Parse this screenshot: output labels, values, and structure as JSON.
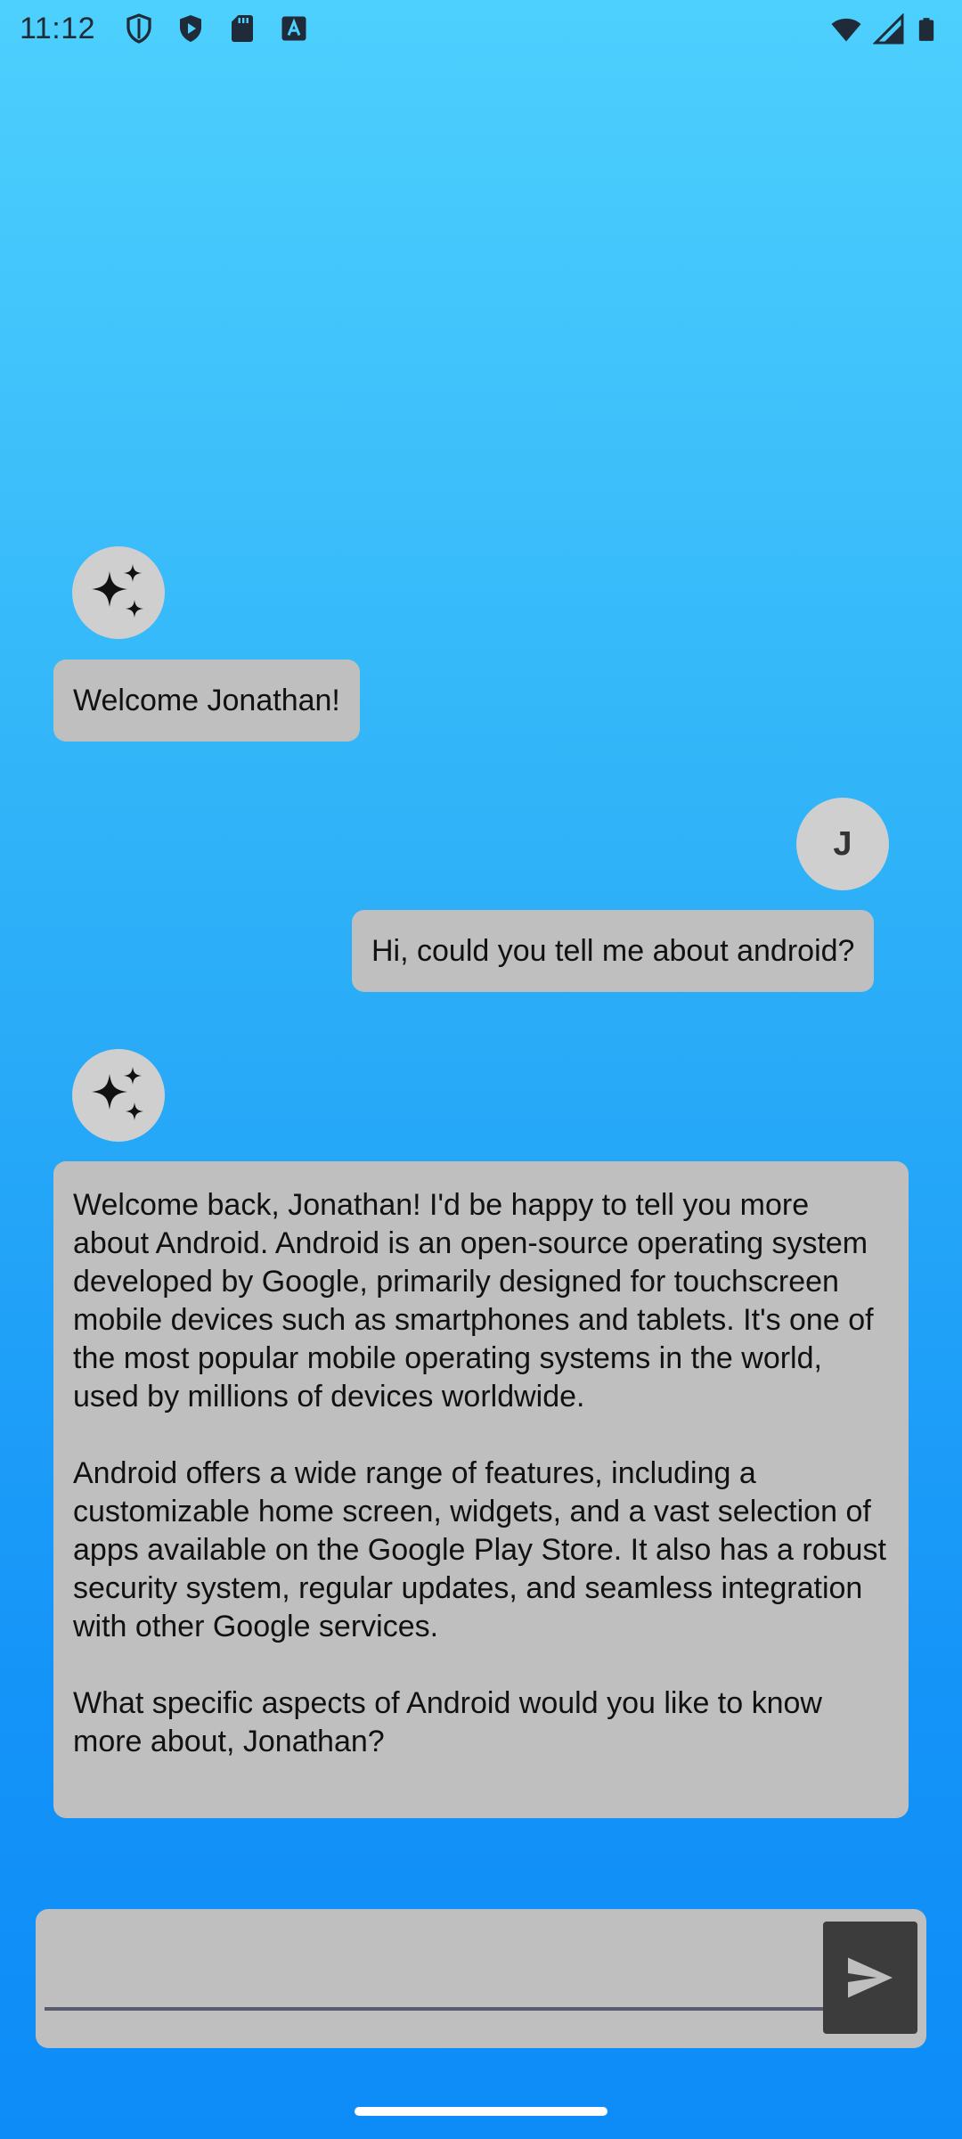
{
  "status_bar": {
    "time": "11:12",
    "left_icons": [
      "shield-icon",
      "play-protect-icon",
      "sd-card-icon",
      "font-a-icon"
    ],
    "right_icons": [
      "wifi-icon",
      "signal-icon",
      "battery-icon"
    ]
  },
  "messages": [
    {
      "sender": "bot",
      "avatar_icon": "sparkles-icon",
      "text": "Welcome Jonathan!"
    },
    {
      "sender": "user",
      "avatar_initial": "J",
      "text": "Hi, could you tell me about android?"
    },
    {
      "sender": "bot",
      "avatar_icon": "sparkles-icon",
      "text": "Welcome back, Jonathan! I'd be happy to tell you more about Android. Android is an open-source operating system developed by Google, primarily designed for touchscreen mobile devices such as smartphones and tablets. It's one of the most popular mobile operating systems in the world, used by millions of devices worldwide.\n\nAndroid offers a wide range of features, including a customizable home screen, widgets, and a vast selection of apps available on the Google Play Store. It also has a robust security system, regular updates, and seamless integration with other Google services.\n\nWhat specific aspects of Android would you like to know more about, Jonathan?"
    }
  ],
  "composer": {
    "value": "",
    "placeholder": "",
    "send_icon": "send-icon"
  },
  "colors": {
    "bubble": "#bfbfbf",
    "avatar": "#cfcfcf",
    "send_button": "#3c3c3c",
    "gradient_top": "#4dd0fd",
    "gradient_bottom": "#0d8cf8"
  }
}
